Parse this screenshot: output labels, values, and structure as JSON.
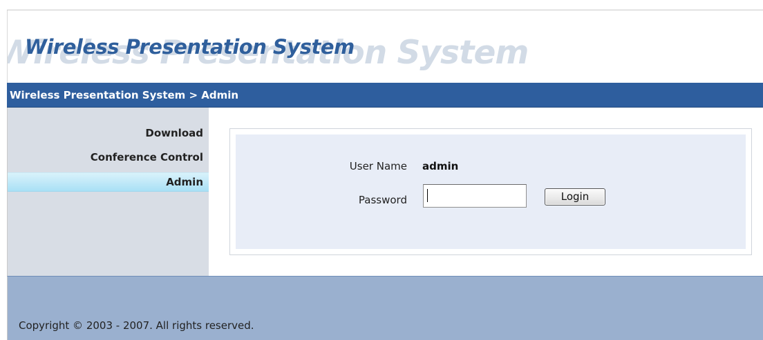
{
  "header": {
    "logo_text": "Wireless Presentation System",
    "logo_ghost_text": "Wireless Presentation System"
  },
  "titlebar": {
    "breadcrumb": "Wireless Presentation System > Admin"
  },
  "sidebar": {
    "items": [
      {
        "label": "Download",
        "active": false
      },
      {
        "label": "Conference Control",
        "active": false
      },
      {
        "label": "Admin",
        "active": true
      }
    ]
  },
  "login_form": {
    "username_label": "User Name",
    "username_value": "admin",
    "password_label": "Password",
    "password_value": "",
    "login_button_label": "Login"
  },
  "footer": {
    "copyright": "Copyright © 2003 - 2007. All rights reserved."
  },
  "colors": {
    "titlebar_bg": "#2e5e9e",
    "logo_blue": "#2f5f9c",
    "sidebar_bg": "#d8dde5",
    "active_item_bg": "#a9e0f5",
    "panel_bg": "#e8edf7",
    "footer_bg": "#9ab0cf"
  }
}
